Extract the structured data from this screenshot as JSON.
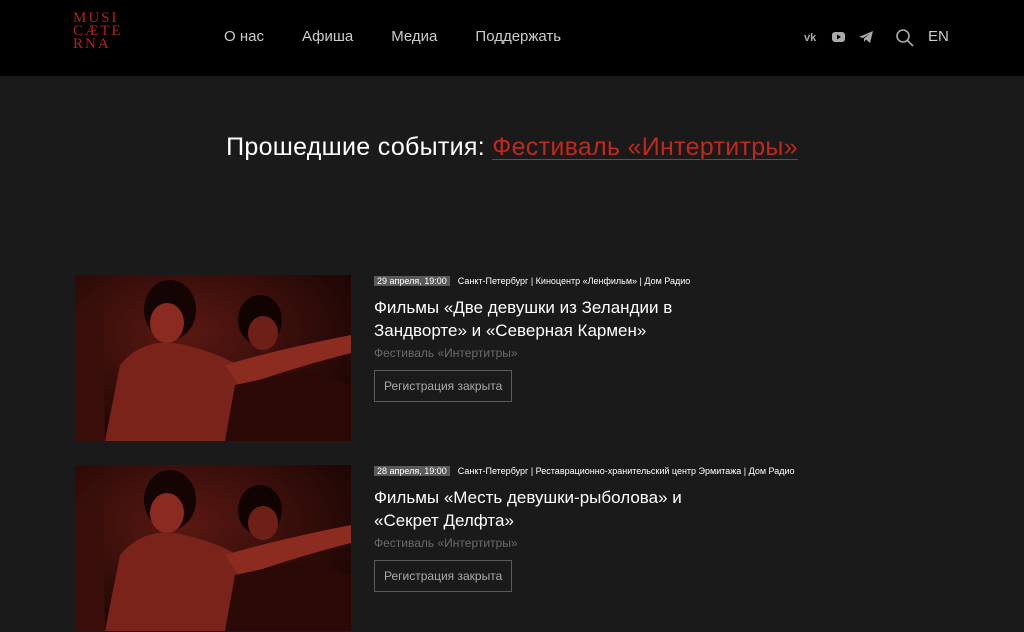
{
  "header": {
    "logo_lines": [
      "MUSI",
      "CÆTE",
      "RNA"
    ],
    "nav": [
      "О нас",
      "Афиша",
      "Медиа",
      "Поддержать"
    ],
    "social_icons": [
      "vk-icon",
      "youtube-icon",
      "telegram-icon"
    ],
    "lang": "EN"
  },
  "page": {
    "title_prefix": "Прошедшие события:",
    "title_link": "Фестиваль «Интертитры»"
  },
  "events": [
    {
      "date": "29 апреля, 19:00",
      "location": "Санкт-Петербург | Киноцентр «Ленфильм» | Дом Радио",
      "title": "Фильмы «Две девушки из Зеландии в Зандворте» и «Северная Кармен»",
      "festival": "Фестиваль «Интертитры»",
      "button": "Регистрация закрыта"
    },
    {
      "date": "28 апреля, 19:00",
      "location": "Санкт-Петербург | Реставрационно-хранительский центр Эрмитажа | Дом Радио",
      "title": "Фильмы «Месть девушки-рыболова» и «Секрет Делфта»",
      "festival": "Фестиваль «Интертитры»",
      "button": "Регистрация закрыта"
    }
  ],
  "colors": {
    "accent": "#c0281e",
    "logo": "#b3221c",
    "header_bg": "#000000",
    "page_bg": "#1a1a1a"
  }
}
